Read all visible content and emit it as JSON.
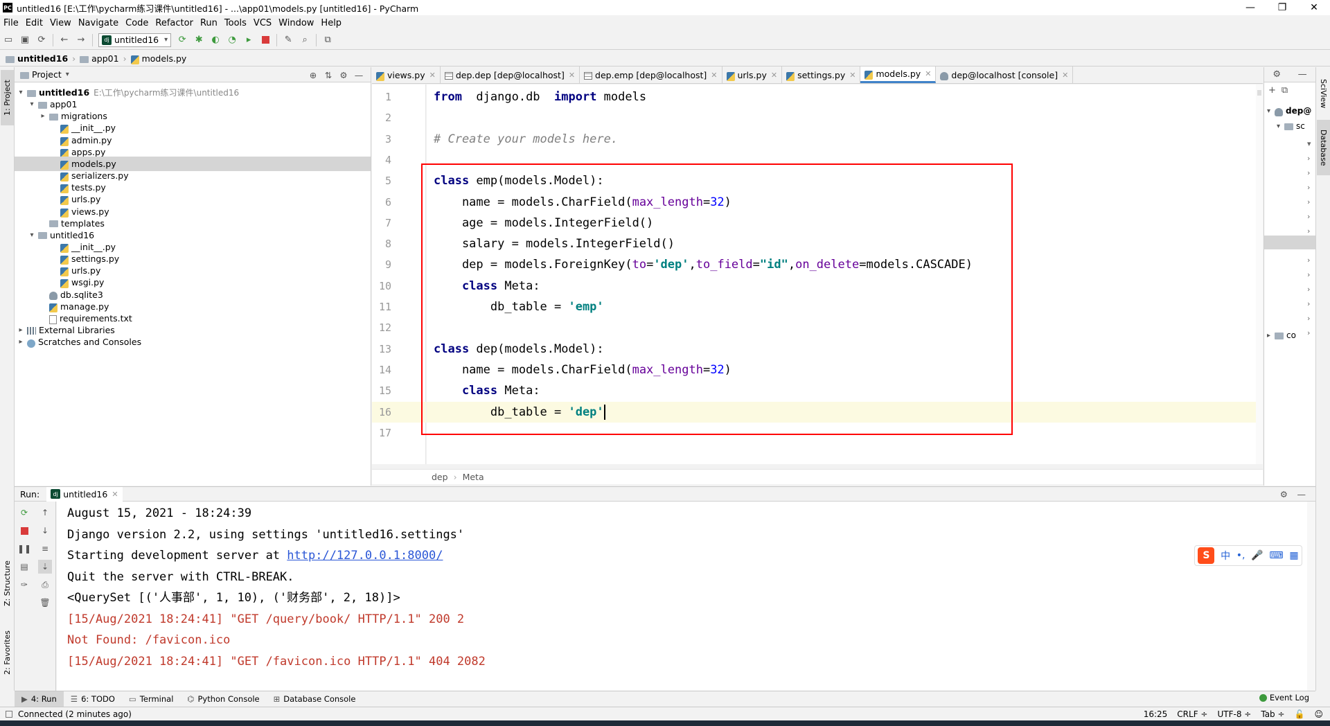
{
  "window": {
    "title": "untitled16 [E:\\工作\\pycharm练习课件\\untitled16] - ...\\app01\\models.py [untitled16] - PyCharm",
    "logo": "PC",
    "minimize": "—",
    "restore": "❐",
    "close": "✕"
  },
  "menu": [
    "File",
    "Edit",
    "View",
    "Navigate",
    "Code",
    "Refactor",
    "Run",
    "Tools",
    "VCS",
    "Window",
    "Help"
  ],
  "toolbar": {
    "run_config": "untitled16",
    "dj": "dj"
  },
  "nav": {
    "crumbs": [
      "untitled16",
      "app01",
      "models.py"
    ]
  },
  "leftstrip": {
    "project": "1: Project",
    "structure": "Z: Structure",
    "favorites": "2: Favorites"
  },
  "project": {
    "header": "Project",
    "tree": [
      {
        "label": "untitled16",
        "path": "E:\\工作\\pycharm练习课件\\untitled16",
        "depth": 0,
        "chev": "▾",
        "icon": "folder",
        "bold": true
      },
      {
        "label": "app01",
        "depth": 1,
        "chev": "▾",
        "icon": "folder"
      },
      {
        "label": "migrations",
        "depth": 2,
        "chev": "▸",
        "icon": "folder"
      },
      {
        "label": "__init__.py",
        "depth": 3,
        "chev": "",
        "icon": "py"
      },
      {
        "label": "admin.py",
        "depth": 3,
        "chev": "",
        "icon": "py"
      },
      {
        "label": "apps.py",
        "depth": 3,
        "chev": "",
        "icon": "py"
      },
      {
        "label": "models.py",
        "depth": 3,
        "chev": "",
        "icon": "py",
        "selected": true
      },
      {
        "label": "serializers.py",
        "depth": 3,
        "chev": "",
        "icon": "py"
      },
      {
        "label": "tests.py",
        "depth": 3,
        "chev": "",
        "icon": "py"
      },
      {
        "label": "urls.py",
        "depth": 3,
        "chev": "",
        "icon": "py"
      },
      {
        "label": "views.py",
        "depth": 3,
        "chev": "",
        "icon": "py"
      },
      {
        "label": "templates",
        "depth": 2,
        "chev": "",
        "icon": "folder"
      },
      {
        "label": "untitled16",
        "depth": 1,
        "chev": "▾",
        "icon": "folder"
      },
      {
        "label": "__init__.py",
        "depth": 3,
        "chev": "",
        "icon": "py"
      },
      {
        "label": "settings.py",
        "depth": 3,
        "chev": "",
        "icon": "py"
      },
      {
        "label": "urls.py",
        "depth": 3,
        "chev": "",
        "icon": "py"
      },
      {
        "label": "wsgi.py",
        "depth": 3,
        "chev": "",
        "icon": "py"
      },
      {
        "label": "db.sqlite3",
        "depth": 2,
        "chev": "",
        "icon": "db"
      },
      {
        "label": "manage.py",
        "depth": 2,
        "chev": "",
        "icon": "py"
      },
      {
        "label": "requirements.txt",
        "depth": 2,
        "chev": "",
        "icon": "txt"
      },
      {
        "label": "External Libraries",
        "depth": 0,
        "chev": "▸",
        "icon": "lib"
      },
      {
        "label": "Scratches and Consoles",
        "depth": 0,
        "chev": "▸",
        "icon": "scr"
      }
    ]
  },
  "tabs": [
    {
      "label": "views.py",
      "icon": "py"
    },
    {
      "label": "dep.dep [dep@localhost]",
      "icon": "tbl"
    },
    {
      "label": "dep.emp [dep@localhost]",
      "icon": "tbl"
    },
    {
      "label": "urls.py",
      "icon": "py"
    },
    {
      "label": "settings.py",
      "icon": "py"
    },
    {
      "label": "models.py",
      "icon": "py",
      "active": true
    },
    {
      "label": "dep@localhost [console]",
      "icon": "db"
    }
  ],
  "code": {
    "line_numbers": [
      "1",
      "2",
      "3",
      "4",
      "5",
      "6",
      "7",
      "8",
      "9",
      "10",
      "11",
      "12",
      "13",
      "14",
      "15",
      "16",
      "17"
    ],
    "lines": [
      [
        [
          "kw",
          "from"
        ],
        [
          "",
          "  django.db  "
        ],
        [
          "kw",
          "import"
        ],
        [
          "",
          " models"
        ]
      ],
      [],
      [
        [
          "cm",
          "# Create your models here."
        ]
      ],
      [],
      [
        [
          "kw",
          "class"
        ],
        [
          "",
          " emp(models.Model):"
        ]
      ],
      [
        [
          "",
          "    name = models.CharField("
        ],
        [
          "kwarg",
          "max_length"
        ],
        [
          "",
          "="
        ],
        [
          "nm",
          "32"
        ],
        [
          "",
          ")"
        ]
      ],
      [
        [
          "",
          "    age = models.IntegerField()"
        ]
      ],
      [
        [
          "",
          "    salary = models.IntegerField()"
        ]
      ],
      [
        [
          "",
          "    dep = models.ForeignKey("
        ],
        [
          "kwarg",
          "to"
        ],
        [
          "",
          "="
        ],
        [
          "st",
          "'dep'"
        ],
        [
          "",
          ","
        ],
        [
          "kwarg",
          "to_field"
        ],
        [
          "",
          "="
        ],
        [
          "st",
          "\"id\""
        ],
        [
          "",
          ","
        ],
        [
          "kwarg",
          "on_delete"
        ],
        [
          "",
          "=models.CASCADE)"
        ]
      ],
      [
        [
          "",
          "    "
        ],
        [
          "kw",
          "class"
        ],
        [
          "",
          " Meta:"
        ]
      ],
      [
        [
          "",
          "        db_table = "
        ],
        [
          "st",
          "'emp'"
        ]
      ],
      [],
      [
        [
          "kw",
          "class"
        ],
        [
          "",
          " dep(models.Model):"
        ]
      ],
      [
        [
          "",
          "    name = models.CharField("
        ],
        [
          "kwarg",
          "max_length"
        ],
        [
          "",
          "="
        ],
        [
          "nm",
          "32"
        ],
        [
          "",
          ")"
        ]
      ],
      [
        [
          "",
          "    "
        ],
        [
          "kw",
          "class"
        ],
        [
          "",
          " Meta:"
        ]
      ],
      [
        [
          "",
          "        db_table = "
        ],
        [
          "st",
          "'dep'"
        ]
      ],
      []
    ]
  },
  "breadcrumb": {
    "items": [
      "dep",
      "Meta"
    ]
  },
  "dbpanel": {
    "items": [
      "dep@",
      "sc",
      "co"
    ]
  },
  "rightstrip": {
    "sciview": "SciView",
    "database": "Database"
  },
  "run": {
    "label": "Run:",
    "tab": "untitled16",
    "console": [
      {
        "text": "August 15, 2021 - 18:24:39",
        "type": "normal"
      },
      {
        "text": "Django version 2.2, using settings 'untitled16.settings'",
        "type": "normal"
      },
      {
        "text": "Starting development server at ",
        "link": "http://127.0.0.1:8000/",
        "type": "normal"
      },
      {
        "text": "Quit the server with CTRL-BREAK.",
        "type": "normal"
      },
      {
        "text": "<QuerySet [('人事部', 1, 10), ('财务部', 2, 18)]>",
        "type": "normal"
      },
      {
        "text": "[15/Aug/2021 18:24:41] \"GET /query/book/ HTTP/1.1\" 200 2",
        "type": "err"
      },
      {
        "text": "Not Found: /favicon.ico",
        "type": "err"
      },
      {
        "text": "[15/Aug/2021 18:24:41] \"GET /favicon.ico HTTP/1.1\" 404 2082",
        "type": "err"
      }
    ]
  },
  "ime": {
    "s": "S",
    "zh": "中",
    "punct": "•,",
    "mic": "🎤",
    "kbd": "⌨",
    "grid": "▦"
  },
  "bottom_tabs": [
    {
      "label": "4: Run",
      "icon": "▶",
      "active": true
    },
    {
      "label": "6: TODO",
      "icon": "☰"
    },
    {
      "label": "Terminal",
      "icon": "▭"
    },
    {
      "label": "Python Console",
      "icon": "⌬"
    },
    {
      "label": "Database Console",
      "icon": "⊞"
    }
  ],
  "status": {
    "left": "Connected (2 minutes ago)",
    "position": "16:25",
    "line_sep": "CRLF ÷",
    "encoding": "UTF-8 ÷",
    "indent": "Tab ÷",
    "event_log": "Event Log"
  },
  "colors": {
    "highlight_box": "#ff0000",
    "keyword": "#000080",
    "string": "#008080",
    "number": "#0000ff",
    "kwarg": "#660099",
    "comment": "#808080",
    "error_text": "#c0392b"
  }
}
